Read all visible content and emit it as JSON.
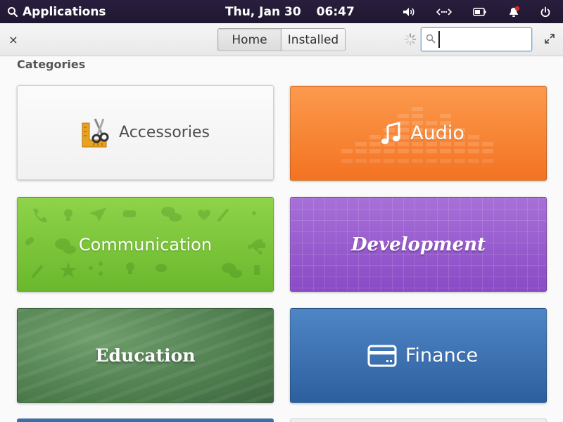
{
  "panel": {
    "apps_label": "Applications",
    "date": "Thu, Jan 30",
    "time": "06:47"
  },
  "header": {
    "close_glyph": "×",
    "tabs": {
      "home": "Home",
      "installed": "Installed"
    },
    "search_value": ""
  },
  "categories_title": "Categories",
  "categories": [
    {
      "id": "accessories",
      "label": "Accessories",
      "color": "#f3f3f3"
    },
    {
      "id": "audio",
      "label": "Audio",
      "color": "#f7832f"
    },
    {
      "id": "communication",
      "label": "Communication",
      "color": "#7cc43a"
    },
    {
      "id": "development",
      "label": "Development",
      "color": "#9658cf"
    },
    {
      "id": "education",
      "label": "Education",
      "color": "#567f54"
    },
    {
      "id": "finance",
      "label": "Finance",
      "color": "#3b6fb0"
    }
  ]
}
